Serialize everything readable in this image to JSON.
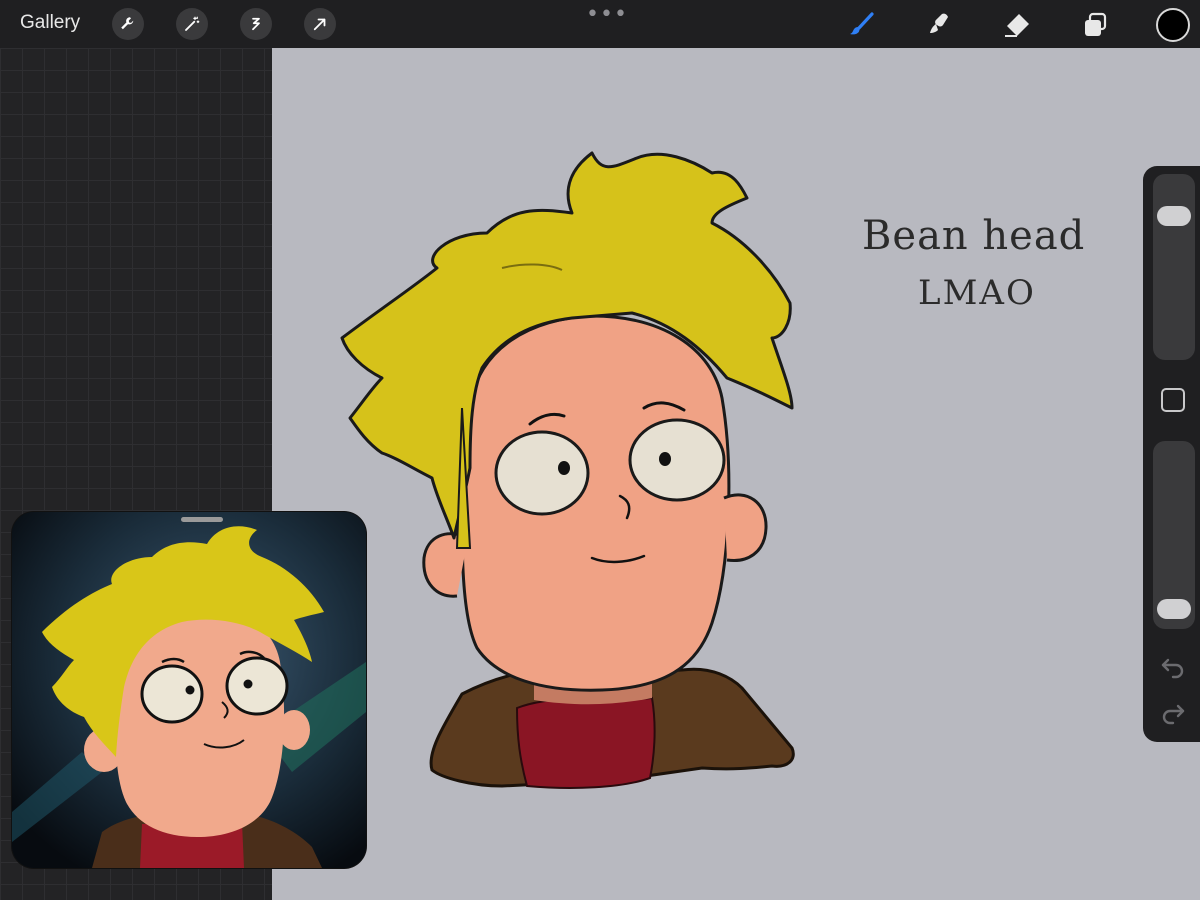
{
  "toolbar": {
    "gallery_label": "Gallery",
    "more_label": "•••",
    "actions": [
      "wrench-icon",
      "magic-wand-icon",
      "selection-icon",
      "transform-arrow-icon"
    ],
    "tools": [
      "brush-icon",
      "smudge-icon",
      "eraser-icon",
      "layers-icon"
    ],
    "active_tool": "brush-icon",
    "active_tool_color": "#2f7ff5",
    "current_color": "#000000"
  },
  "canvas": {
    "note_line1": "Bean head",
    "note_line2": "LMAO"
  },
  "sidebar": {
    "brush_size_level": 0.82,
    "brush_opacity_level": 0.04,
    "modify_button": "square-icon",
    "undo_icon": "undo-icon",
    "redo_icon": "redo-icon"
  },
  "reference": {
    "label": "reference-image"
  },
  "colors": {
    "hair": "#d6c21a",
    "skin": "#f0a285",
    "jacket": "#5a3a1e",
    "shirt": "#8a1524",
    "canvas_bg": "#b8b9c0"
  }
}
